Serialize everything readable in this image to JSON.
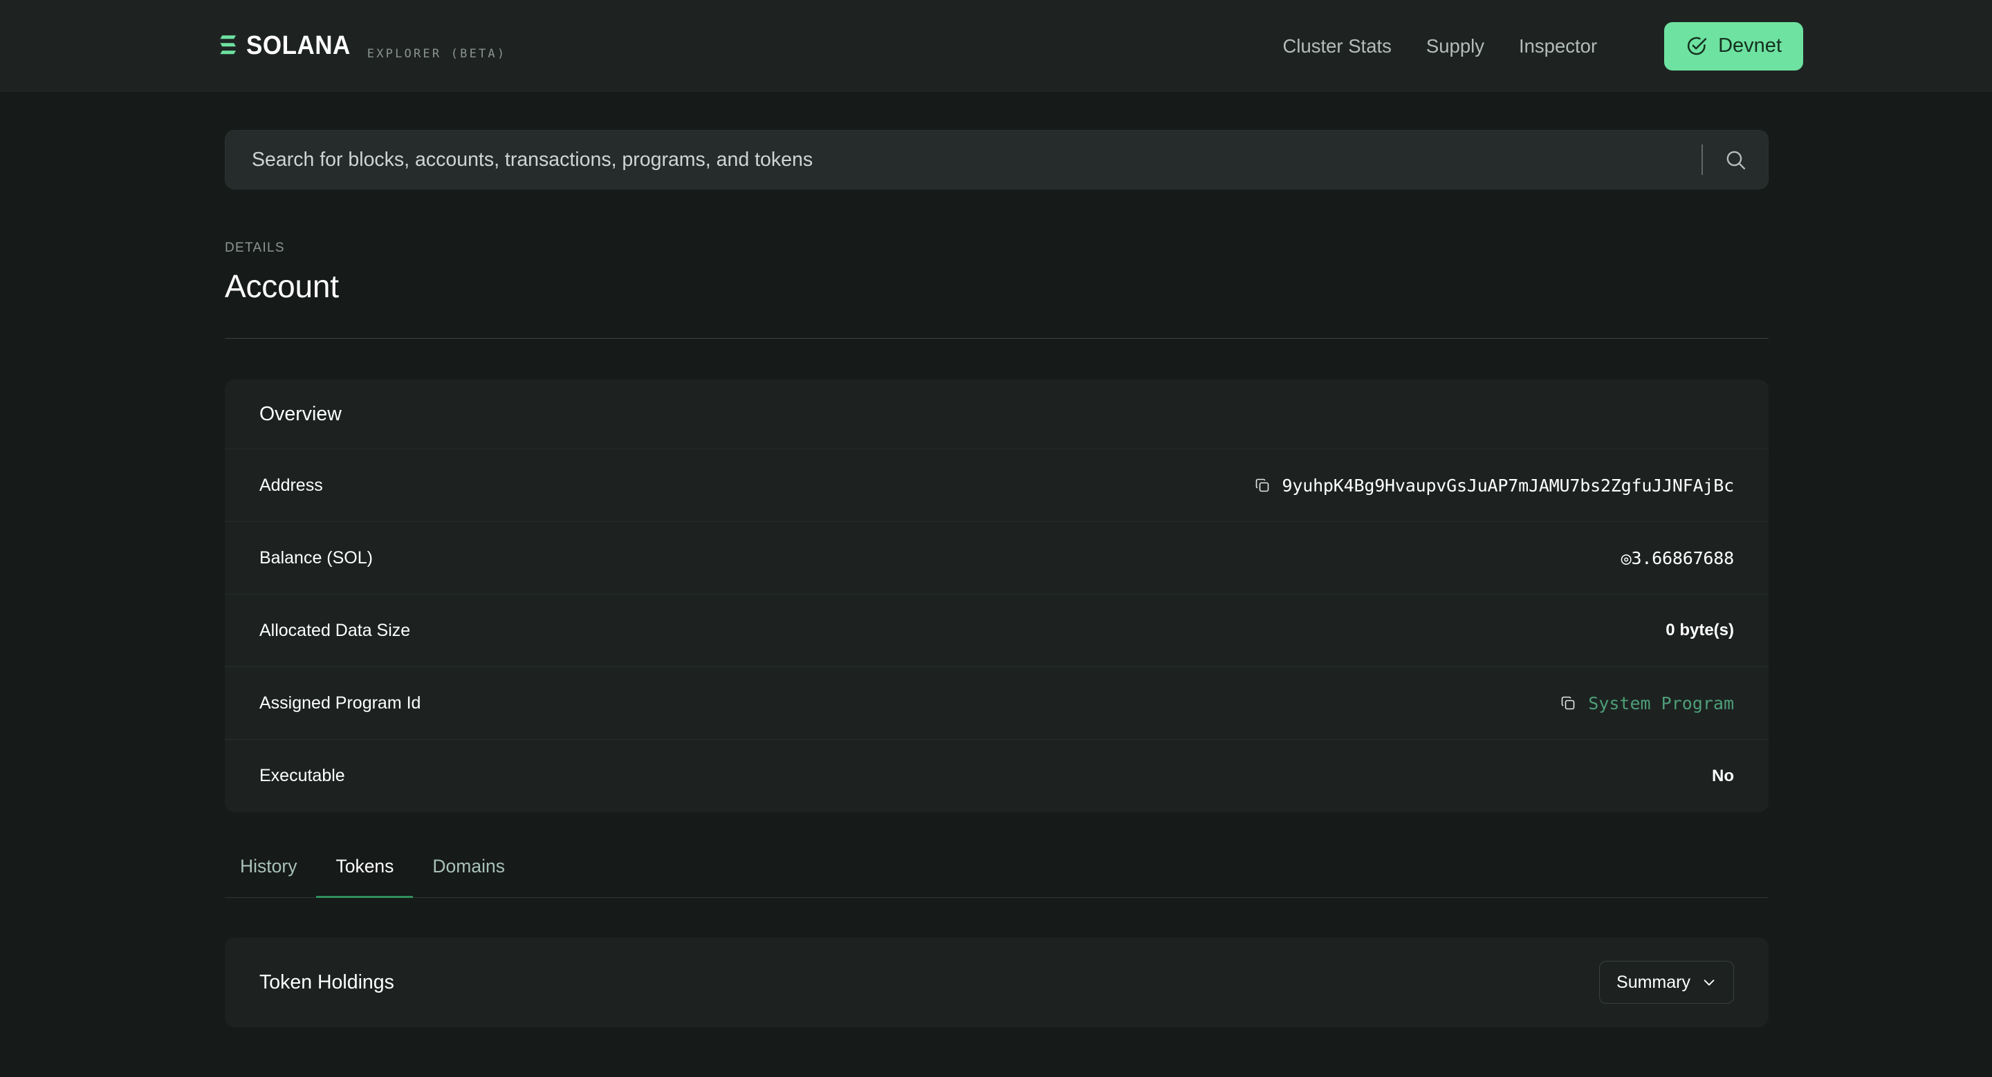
{
  "header": {
    "brand_word": "SOLANA",
    "brand_sub": "EXPLORER (BETA)",
    "logo_icon": "solana-mark-icon",
    "nav_links": [
      {
        "label": "Cluster Stats"
      },
      {
        "label": "Supply"
      },
      {
        "label": "Inspector"
      }
    ],
    "cluster_button": {
      "label": "Devnet",
      "icon": "check-circle-icon",
      "bg_color": "#6ee2a0",
      "text_color": "#14301f"
    }
  },
  "search": {
    "placeholder": "Search for blocks, accounts, transactions, programs, and tokens",
    "value": "",
    "icon": "search-icon"
  },
  "details": {
    "eyebrow": "DETAILS",
    "title": "Account"
  },
  "overview": {
    "card_title": "Overview",
    "rows": [
      {
        "label": "Address",
        "value": "9yuhpK4Bg9HvaupvGsJuAP7mJAMU7bs2ZgfuJJNFAjBc",
        "type": "mono-copy",
        "icon": "copy-icon"
      },
      {
        "label": "Balance (SOL)",
        "value": "◎3.66867688",
        "type": "mono"
      },
      {
        "label": "Allocated Data Size",
        "value": "0 byte(s)",
        "type": "bold"
      },
      {
        "label": "Assigned Program Id",
        "value": "System Program",
        "type": "link-copy",
        "icon": "copy-icon",
        "color": "#4e9e78"
      },
      {
        "label": "Executable",
        "value": "No",
        "type": "bold"
      }
    ]
  },
  "tabs": {
    "items": [
      {
        "label": "History",
        "active": false
      },
      {
        "label": "Tokens",
        "active": true
      },
      {
        "label": "Domains",
        "active": false
      }
    ],
    "active_underline_color": "#2f8f5b"
  },
  "token_holdings": {
    "title": "Token Holdings",
    "dropdown": {
      "label": "Summary",
      "icon": "chevron-down-icon"
    }
  }
}
